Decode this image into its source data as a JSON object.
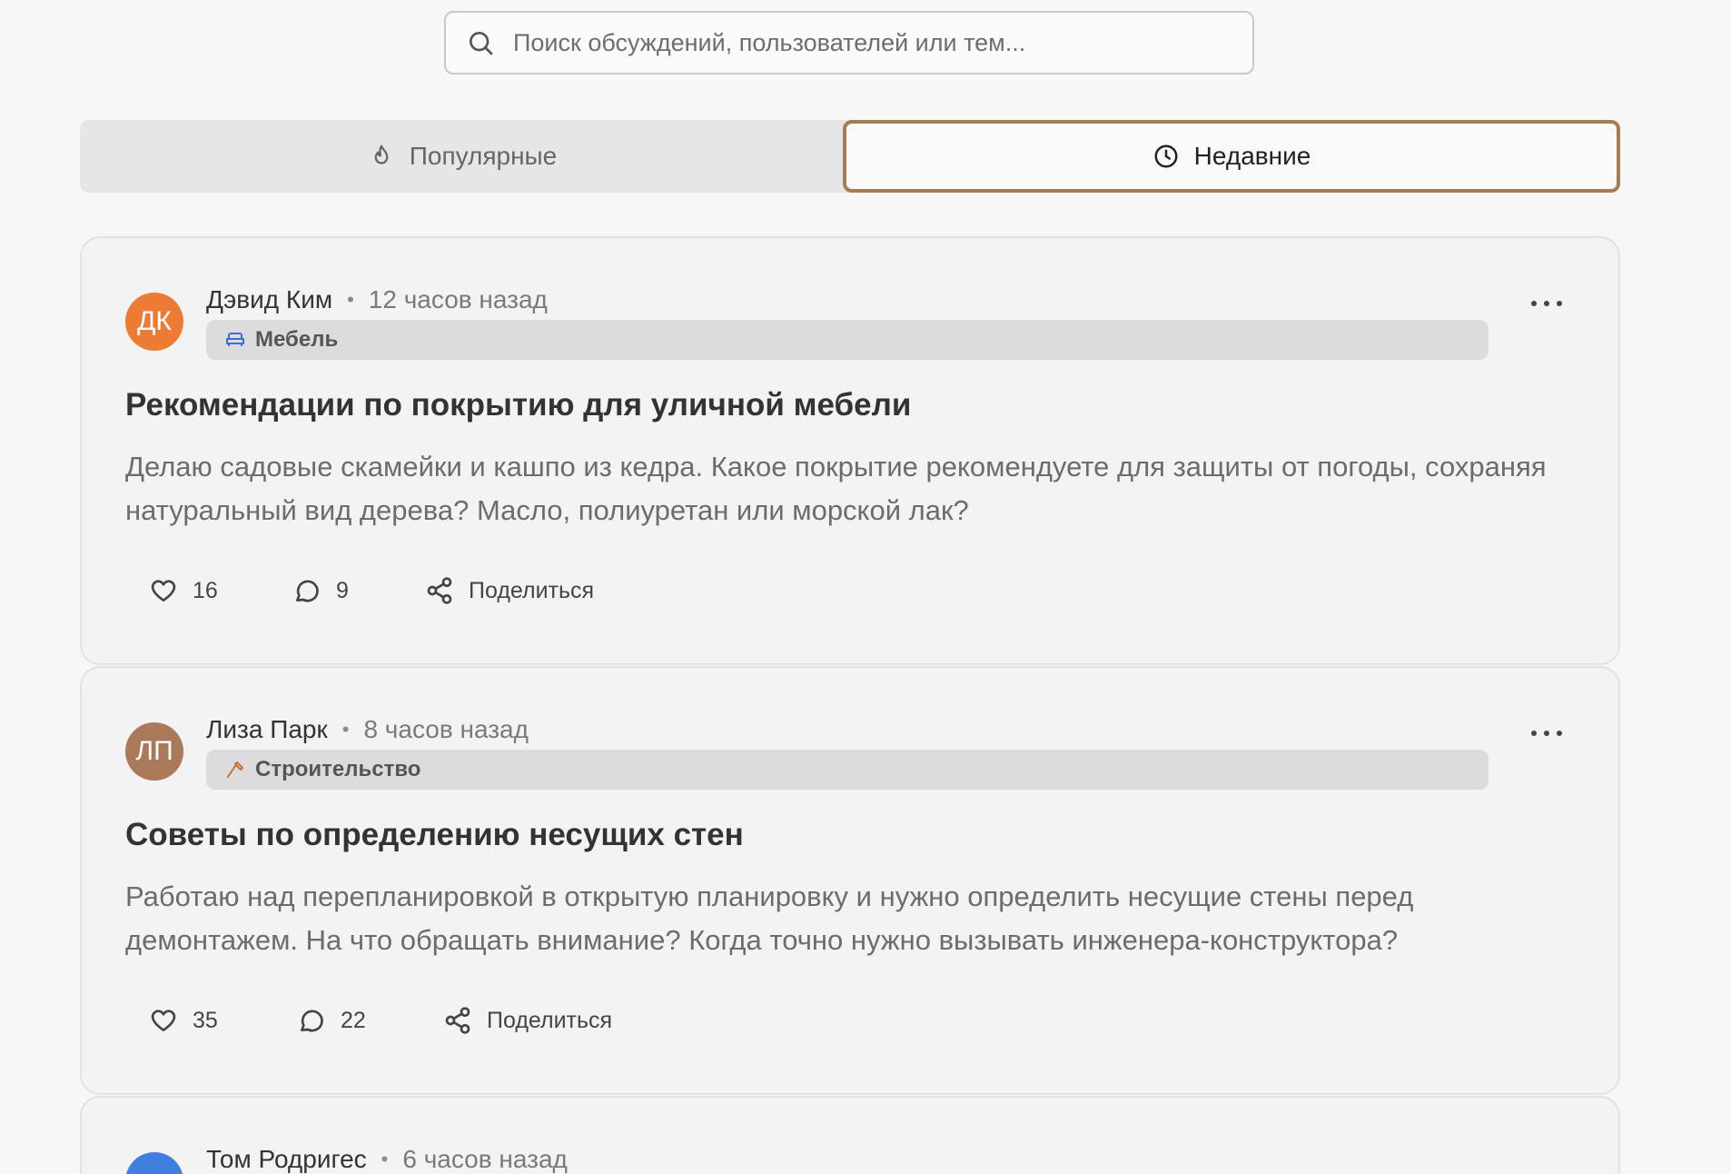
{
  "search": {
    "placeholder": "Поиск обсуждений, пользователей или тем..."
  },
  "tabs": [
    {
      "label": "Популярные",
      "icon": "flame-icon",
      "active": false
    },
    {
      "label": "Недавние",
      "icon": "clock-icon",
      "active": true
    }
  ],
  "colors": {
    "active_tab_border": "#a67c52",
    "avatar_dk": "#ec7b35",
    "avatar_lp": "#a9795a",
    "avatar_tr": "#3f7fe0",
    "category_bg": "#dcdcdd"
  },
  "posts": [
    {
      "initials": "ДК",
      "author": "Дэвид Ким",
      "time": "12 часов назад",
      "category": "Мебель",
      "category_icon": "sofa-icon",
      "title": "Рекомендации по покрытию для уличной мебели",
      "body": "Делаю садовые скамейки и кашпо из кедра. Какое покрытие рекомендуете для защиты от погоды, сохраняя натуральный вид дерева? Масло, полиуретан или морской лак?",
      "likes": "16",
      "comments": "9",
      "share_label": "Поделиться"
    },
    {
      "initials": "ЛП",
      "author": "Лиза Парк",
      "time": "8 часов назад",
      "category": "Строительство",
      "category_icon": "hammer-icon",
      "title": "Советы по определению несущих стен",
      "body": "Работаю над перепланировкой в открытую планировку и нужно определить несущие стены перед демонтажем. На что обращать внимание? Когда точно нужно вызывать инженера-конструктора?",
      "likes": "35",
      "comments": "22",
      "share_label": "Поделиться"
    },
    {
      "author": "Том Родригес",
      "time": "6 часов назад"
    }
  ]
}
